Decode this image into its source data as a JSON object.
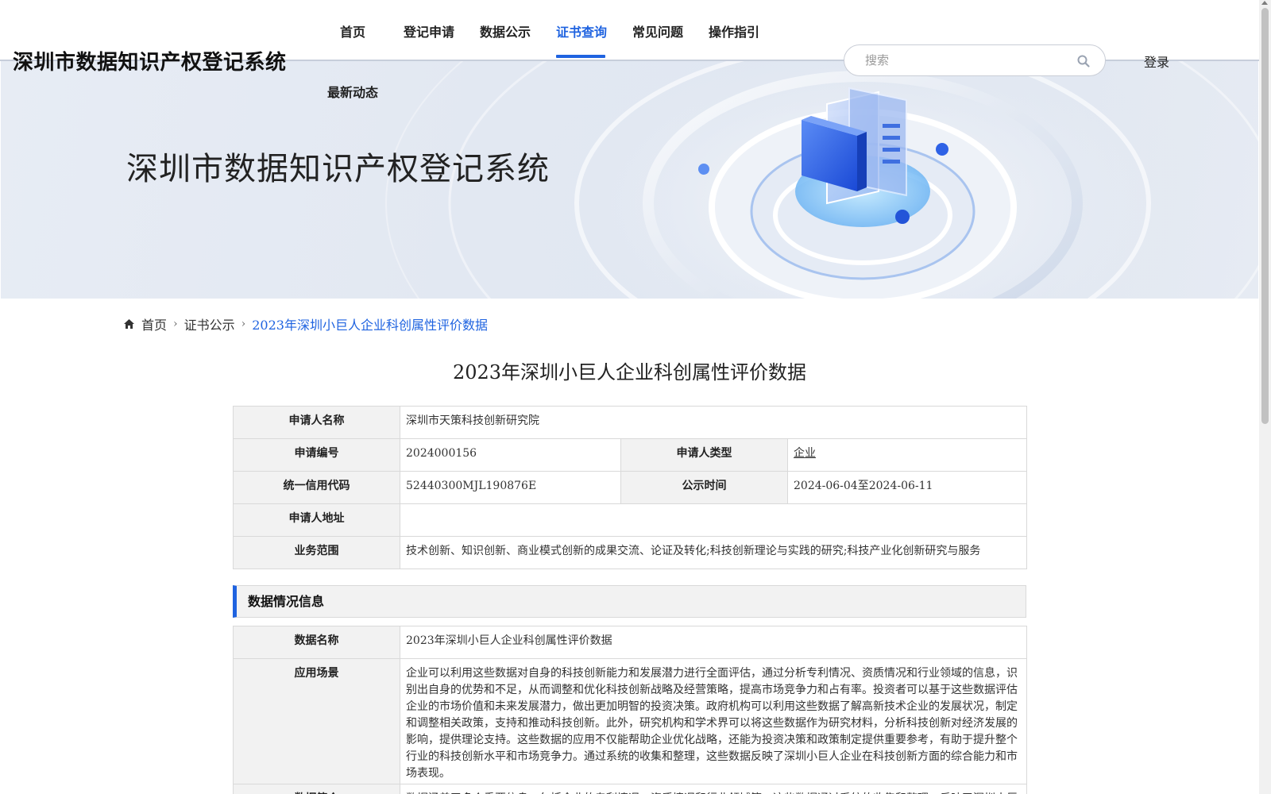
{
  "header": {
    "site_title": "深圳市数据知识产权登记系统",
    "nav": [
      {
        "label": "首页"
      },
      {
        "label": "登记申请"
      },
      {
        "label": "数据公示"
      },
      {
        "label": "证书查询",
        "active": true
      },
      {
        "label": "常见问题"
      },
      {
        "label": "操作指引"
      },
      {
        "label": "最新动态"
      }
    ],
    "search_placeholder": "搜索",
    "login_label": "登录"
  },
  "banner": {
    "title": "深圳市数据知识产权登记系统"
  },
  "breadcrumb": {
    "home": "首页",
    "section": "证书公示",
    "current": "2023年深圳小巨人企业科创属性评价数据"
  },
  "page_title": "2023年深圳小巨人企业科创属性评价数据",
  "applicant": {
    "name_label": "申请人名称",
    "name_value": "深圳市天策科技创新研究院",
    "number_label": "申请编号",
    "number_value": "2024000156",
    "type_label": "申请人类型",
    "type_value": "企业",
    "credit_label": "统一信用代码",
    "credit_value": "52440300MJL190876E",
    "publicity_label": "公示时间",
    "publicity_value": "2024-06-04至2024-06-11",
    "address_label": "申请人地址",
    "address_value": "",
    "scope_label": "业务范围",
    "scope_value": "技术创新、知识创新、商业模式创新的成果交流、论证及转化;科技创新理论与实践的研究;科技产业化创新研究与服务"
  },
  "data_section": {
    "header": "数据情况信息",
    "data_name_label": "数据名称",
    "data_name_value": "2023年深圳小巨人企业科创属性评价数据",
    "scenario_label": "应用场景",
    "scenario_value": "企业可以利用这些数据对自身的科技创新能力和发展潜力进行全面评估，通过分析专利情况、资质情况和行业领域的信息，识别出自身的优势和不足，从而调整和优化科技创新战略及经营策略，提高市场竞争力和占有率。投资者可以基于这些数据评估企业的市场价值和未来发展潜力，做出更加明智的投资决策。政府机构可以利用这些数据了解高新技术企业的发展状况，制定和调整相关政策，支持和推动科技创新。此外，研究机构和学术界可以将这些数据作为研究材料，分析科技创新对经济发展的影响，提供理论支持。这些数据的应用不仅能帮助企业优化战略，还能为投资决策和政策制定提供重要参考，有助于提升整个行业的科技创新水平和市场竞争力。通过系统的收集和整理，这些数据反映了深圳小巨人企业在科技创新方面的综合能力和市场表现。",
    "intro_label": "数据简介",
    "intro_value": "数据涵盖了多个重要信息，包括企业的专利情况、资质情况和行业领域等。这些数据通过系统的收集和整理，反映了深圳小巨"
  },
  "colors": {
    "accent": "#1f63e0",
    "label_bg": "#f2f2f2",
    "border": "#d9d9d9"
  }
}
